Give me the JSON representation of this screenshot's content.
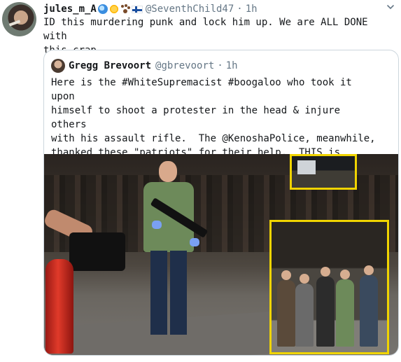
{
  "tweet": {
    "author": {
      "display_name": "jules_m_A",
      "emoji_icons": [
        "wave-icon",
        "sun-icon",
        "paw-icon",
        "finland-flag-icon"
      ],
      "handle": "@SeventhChild47"
    },
    "separator": "·",
    "time": "1h",
    "text": "ID this murdering punk and lock him up. We are ALL DONE with\nthis crap."
  },
  "quoted_tweet": {
    "author": {
      "display_name": "Gregg Brevoort",
      "handle": "@gbrevoort"
    },
    "separator": "·",
    "time": "1h",
    "text": "Here is the #WhiteSupremacist #boogaloo who took it upon\nhimself to shoot a protester in the head & injure others\nwith his assault rifle.  The @KenoshaPolice, meanwhile,\nthanked these \"patriots\" for their help.  THIS is Trump's\nAmerica.  Help identify this murderer and #LockHimUp"
  },
  "colors": {
    "text": "#14171a",
    "secondary": "#657786",
    "border": "#ccd6dd",
    "inset_highlight": "#f0d400"
  }
}
